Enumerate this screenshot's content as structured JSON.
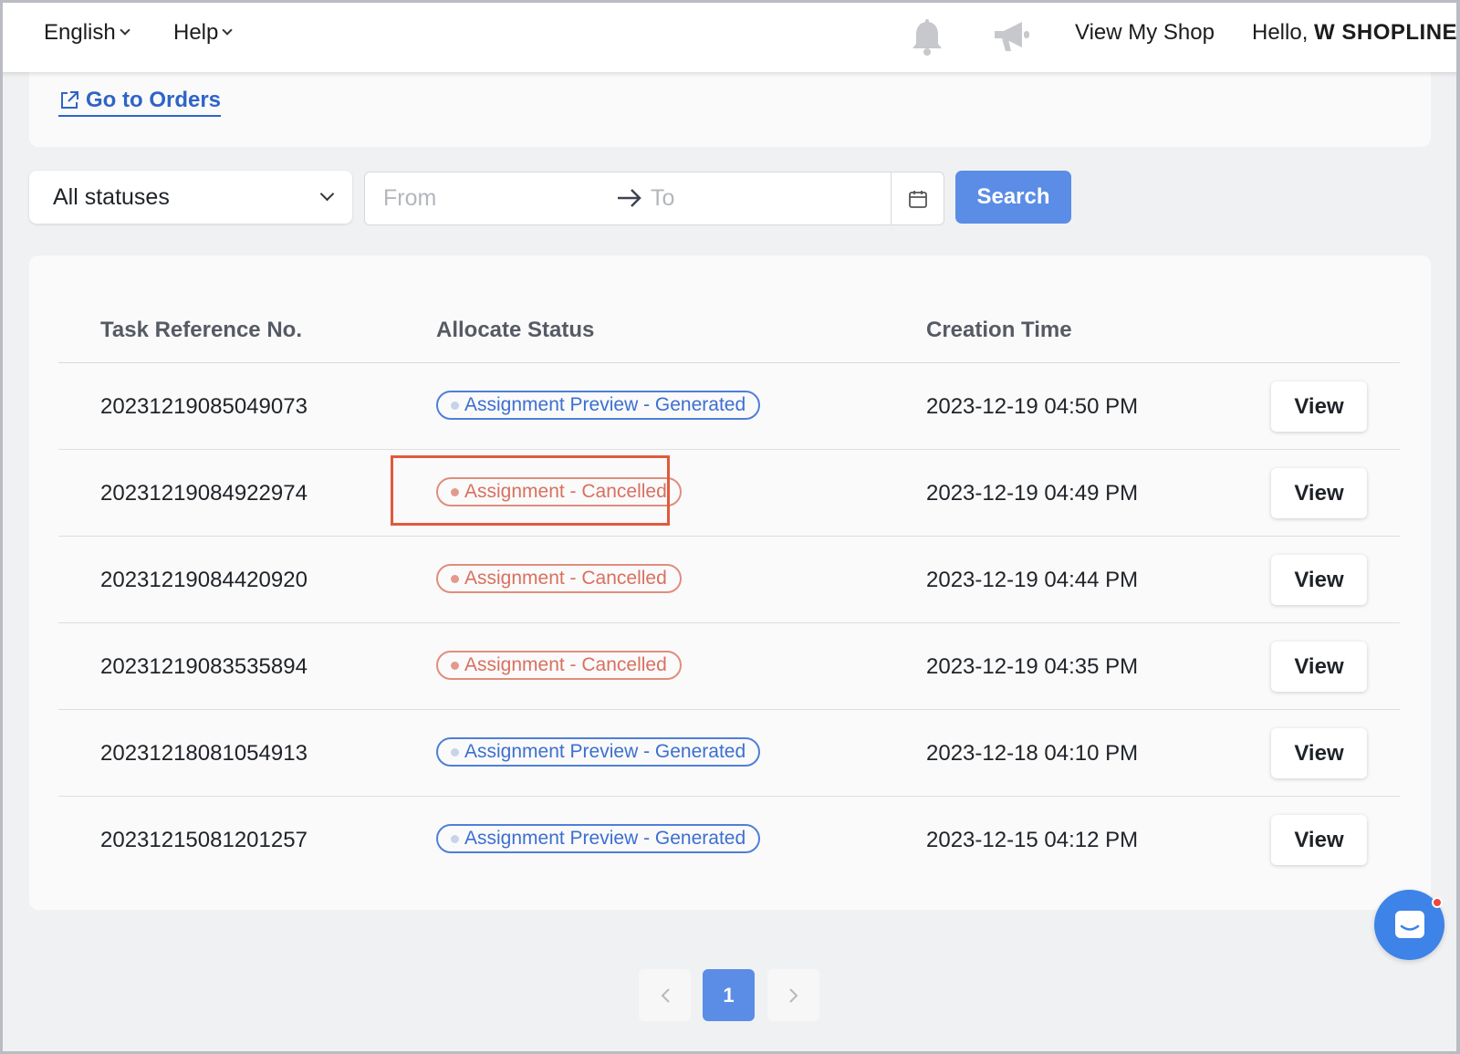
{
  "header": {
    "language": "English",
    "help": "Help",
    "view_shop": "View My Shop",
    "greeting": "Hello,",
    "shop_name": "W SHOPLINE",
    "icons": [
      "bell-icon",
      "megaphone-icon"
    ]
  },
  "top_card": {
    "go_to_orders": "Go to Orders"
  },
  "filters": {
    "status_selected": "All statuses",
    "from_placeholder": "From",
    "to_placeholder": "To",
    "search_label": "Search"
  },
  "table": {
    "headers": [
      "Task Reference No.",
      "Allocate Status",
      "Creation Time"
    ],
    "rows": [
      {
        "ref": "20231219085049073",
        "status": "Assignment Preview - Generated",
        "status_type": "generated",
        "time": "2023-12-19 04:50 PM",
        "action": "View"
      },
      {
        "ref": "20231219084922974",
        "status": "Assignment - Cancelled",
        "status_type": "cancelled",
        "time": "2023-12-19 04:49 PM",
        "action": "View"
      },
      {
        "ref": "20231219084420920",
        "status": "Assignment - Cancelled",
        "status_type": "cancelled",
        "time": "2023-12-19 04:44 PM",
        "action": "View"
      },
      {
        "ref": "20231219083535894",
        "status": "Assignment - Cancelled",
        "status_type": "cancelled",
        "time": "2023-12-19 04:35 PM",
        "action": "View"
      },
      {
        "ref": "20231218081054913",
        "status": "Assignment Preview - Generated",
        "status_type": "generated",
        "time": "2023-12-18 04:10 PM",
        "action": "View"
      },
      {
        "ref": "20231215081201257",
        "status": "Assignment Preview - Generated",
        "status_type": "generated",
        "time": "2023-12-15 04:12 PM",
        "action": "View"
      }
    ]
  },
  "pagination": {
    "current_page": "1"
  },
  "colors": {
    "accent": "#5b8de6",
    "link": "#2f64c7",
    "generated": "#3c6fd1",
    "cancelled": "#d9705f",
    "highlight": "#e05a3e"
  }
}
